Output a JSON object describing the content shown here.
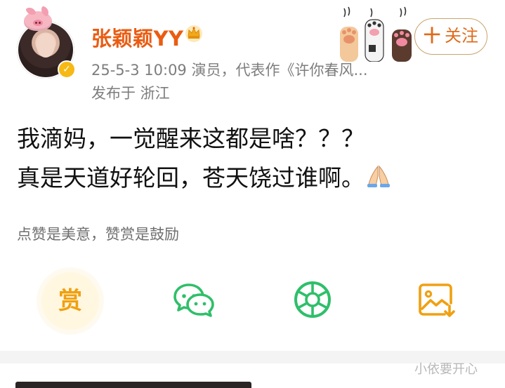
{
  "header": {
    "username": "张颖颖YY",
    "meta": "25-5-3 10:09  演员，代表作《许你春风...",
    "location": "发布于 浙江",
    "follow_label": "关注",
    "follow_plus": "十"
  },
  "post": {
    "line1": "我滴妈，一觉醒来这都是啥？？？",
    "line2": "真是天道好轮回，苍天饶过谁啊。"
  },
  "hint": "点赞是美意，赞赏是鼓励",
  "actions": {
    "reward_label": "赏"
  },
  "watermark": "小依要开心",
  "icons": {
    "verified": "verified-badge-icon",
    "vip": "crown-icon",
    "pray": "pray-hands-icon",
    "wechat": "wechat-icon",
    "moments": "moments-icon",
    "save": "save-image-icon"
  },
  "colors": {
    "username": "#ea5c12",
    "accent": "#f0a010",
    "green": "#2fbf6a",
    "verified": "#f6b915"
  }
}
